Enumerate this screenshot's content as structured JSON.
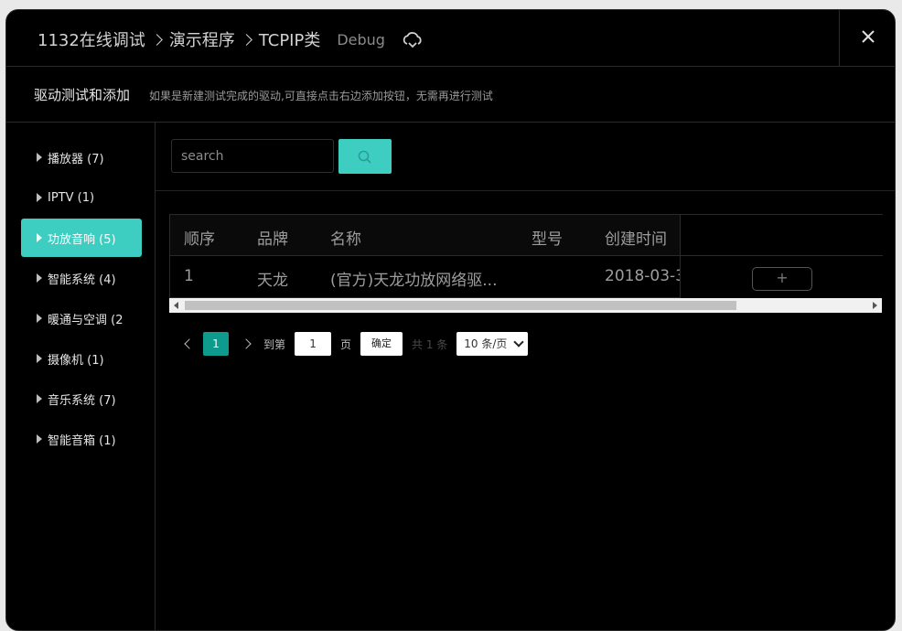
{
  "header": {
    "breadcrumb": [
      "1132在线调试",
      "演示程序",
      "TCPIP类"
    ],
    "mode": "Debug"
  },
  "subheader": {
    "title": "驱动测试和添加",
    "description": "如果是新建测试完成的驱动,可直接点击右边添加按钮，无需再进行测试"
  },
  "sidebar": {
    "items": [
      {
        "label": "播放器 (7)",
        "active": false
      },
      {
        "label": "IPTV (1)",
        "active": false
      },
      {
        "label": "功放音响 (5)",
        "active": true
      },
      {
        "label": "智能系统 (4)",
        "active": false
      },
      {
        "label": "暖通与空调 (2",
        "active": false
      },
      {
        "label": "摄像机 (1)",
        "active": false
      },
      {
        "label": "音乐系统 (7)",
        "active": false
      },
      {
        "label": "智能音箱 (1)",
        "active": false
      }
    ]
  },
  "search": {
    "placeholder": "search",
    "value": ""
  },
  "table": {
    "columns": [
      "顺序",
      "品牌",
      "名称",
      "型号",
      "创建时间"
    ],
    "rows": [
      {
        "order": "1",
        "brand": "天龙",
        "name": "(官方)天龙功放网络驱...",
        "model": "",
        "created": "2018-03-3"
      }
    ],
    "add_label": "+"
  },
  "pagination": {
    "current_page": "1",
    "goto_label": "到第",
    "goto_value": "1",
    "page_label": "页",
    "confirm_label": "确定",
    "total_label": "共 1 条",
    "page_size": "10 条/页"
  },
  "colors": {
    "accent": "#3dcdc1",
    "page_active": "#0f9a8e",
    "background": "#000000"
  },
  "icons": [
    "chevron-right-icon",
    "cloud-icon",
    "close-icon",
    "triangle-right-icon",
    "search-icon"
  ]
}
